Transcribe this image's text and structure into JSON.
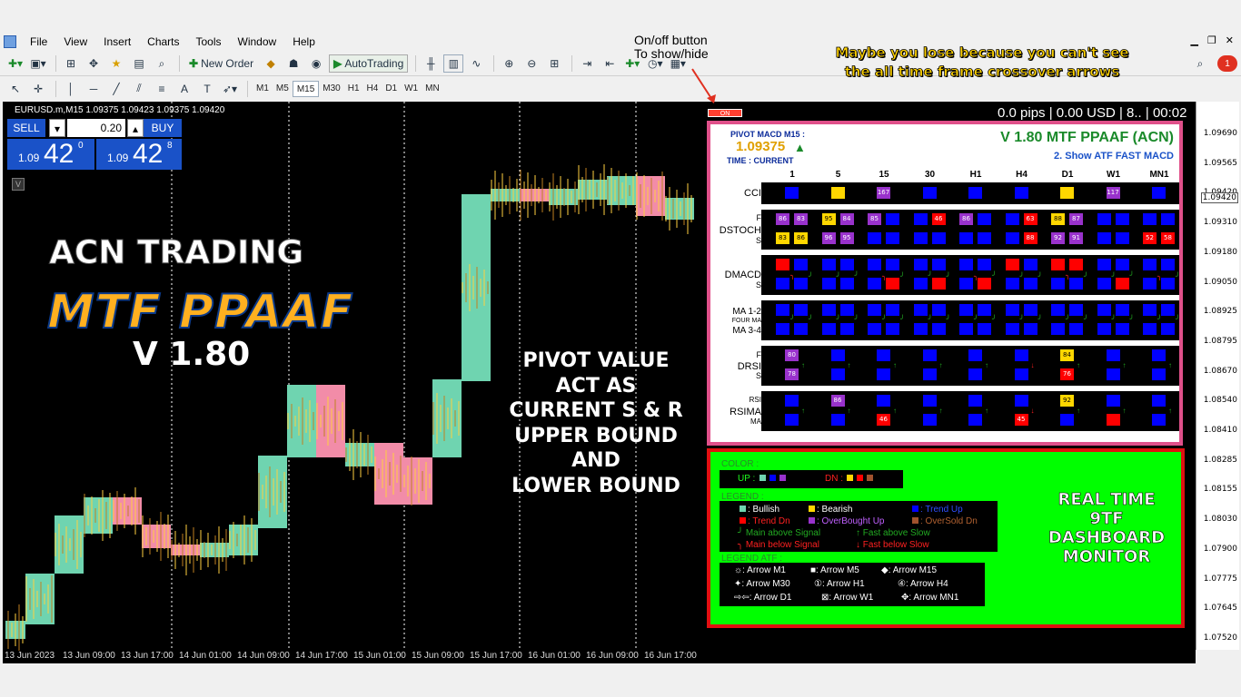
{
  "menu": [
    "File",
    "View",
    "Insert",
    "Charts",
    "Tools",
    "Window",
    "Help"
  ],
  "toolbar": {
    "new_order": "New Order",
    "auto_trading": "AutoTrading"
  },
  "timeframes": [
    "M1",
    "M5",
    "M15",
    "M30",
    "H1",
    "H4",
    "D1",
    "W1",
    "MN"
  ],
  "selected_timeframe": "M15",
  "chart": {
    "ohlc_line": "EURUSD.m,M15  1.09375 1.09423 1.09375 1.09420",
    "current_price": "1.09420",
    "price_labels": [
      "1.09690",
      "1.09565",
      "1.09420",
      "1.09310",
      "1.09180",
      "1.09050",
      "1.08925",
      "1.08795",
      "1.08670",
      "1.08540",
      "1.08410",
      "1.08285",
      "1.08155",
      "1.08030",
      "1.07900",
      "1.07775",
      "1.07645",
      "1.07520"
    ],
    "time_labels": [
      "13 Jun 2023",
      "13 Jun 09:00",
      "13 Jun 17:00",
      "14 Jun 01:00",
      "14 Jun 09:00",
      "14 Jun 17:00",
      "15 Jun 01:00",
      "15 Jun 09:00",
      "15 Jun 17:00",
      "16 Jun 01:00",
      "16 Jun 09:00",
      "16 Jun 17:00"
    ],
    "info_bar": "0.0 pips | 0.00 USD | 8.. | 00:02"
  },
  "trade_panel": {
    "sell": "SELL",
    "buy": "BUY",
    "lot": "0.20",
    "sell_small": "1.09",
    "sell_big": "42",
    "sell_sup": "0",
    "buy_small": "1.09",
    "buy_big": "42",
    "buy_sup": "8"
  },
  "v_button": "V",
  "branding": {
    "line1": "ACN TRADING",
    "line2": "MTF PPAAF",
    "line3": "V 1.80"
  },
  "pivot_text": [
    "PIVOT VALUE",
    "ACT AS",
    "CURRENT S & R",
    "UPPER BOUND",
    "AND",
    "LOWER BOUND"
  ],
  "annotations": {
    "top_banner_1": "Maybe you lose because you can't see",
    "top_banner_2": "the all time frame crossover arrows",
    "button_note_1": "On/off button",
    "button_note_2": "To show/hide",
    "on_button": "ON"
  },
  "dashboard": {
    "pivot_label": "PIVOT MACD M15 :",
    "pivot_value": "1.09375",
    "time_label": "TIME : CURRENT",
    "version": "V 1.80 MTF PPAAF (ACN)",
    "subtitle": "2. Show ATF FAST MACD",
    "tf_headers": [
      "1",
      "5",
      "15",
      "30",
      "H1",
      "H4",
      "D1",
      "W1",
      "MN1"
    ],
    "labels": {
      "cci": "CCI",
      "f1": "F",
      "dstoch": "DSTOCH",
      "s1": "S",
      "dmacd": "DMACD",
      "s2": "S",
      "ma12": "MA 1-2",
      "fourma": "FOUR MA",
      "ma34": "MA 3-4",
      "f3": "F",
      "drsi": "DRSI",
      "s3": "S",
      "rsi": "RSI",
      "rsima": "RSIMA",
      "ma": "MA"
    },
    "cci_values": [
      "",
      "",
      "167",
      "",
      "",
      "",
      "",
      "117",
      ""
    ],
    "dstoch_f": [
      "86",
      "83",
      "95",
      "84",
      "85",
      "",
      "",
      "46",
      "86",
      "",
      "",
      "63",
      "88",
      "87",
      "",
      "",
      "",
      ""
    ],
    "dstoch_s": [
      "83",
      "86",
      "96",
      "95",
      "",
      "",
      "",
      "",
      "",
      "",
      "",
      "88",
      "92",
      "91",
      "",
      "",
      "52",
      "58"
    ],
    "drsi_f": [
      "80",
      "",
      "",
      "",
      "",
      "",
      "84",
      "",
      ""
    ],
    "drsi_s": [
      "78",
      "",
      "",
      "",
      "",
      "",
      "76",
      "",
      ""
    ],
    "rsima_r": [
      "",
      "86",
      "",
      "",
      "",
      "",
      "92",
      "",
      ""
    ],
    "rsima_m": [
      "",
      "",
      "46",
      "",
      "",
      "45",
      "",
      "",
      ""
    ]
  },
  "legend": {
    "color_title": "COLOR :",
    "up_label": "UP :",
    "dn_label": "DN :",
    "legend_title": "LEGEND :",
    "items": [
      ": Bullish",
      ": Bearish",
      ": Trend Up",
      ": Trend Dn",
      ": OverBought Up",
      ": OverSold Dn",
      "Main above Signal",
      "Fast above Slow",
      "Main below Signal",
      "Fast below Slow"
    ],
    "atf_title": "LEGEND ATF :",
    "atf_items": [
      ": Arrow M1",
      ": Arrow M5",
      ": Arrow M15",
      ": Arrow M30",
      ": Arrow H1",
      ": Arrow H4",
      ": Arrow D1",
      ": Arrow W1",
      ": Arrow MN1"
    ],
    "realtime": [
      "REAL TIME",
      "9TF",
      "DASHBOARD",
      "MONITOR"
    ]
  },
  "colors": {
    "bull": "#6fd4b0",
    "bear": "#f28ca8",
    "blue": "#0000ff",
    "red": "#ff0000",
    "purple": "#9932cc",
    "yellow": "#ffd700",
    "green": "#00ff00",
    "frame_pink": "#e0508a",
    "frame_red": "#e01010"
  }
}
